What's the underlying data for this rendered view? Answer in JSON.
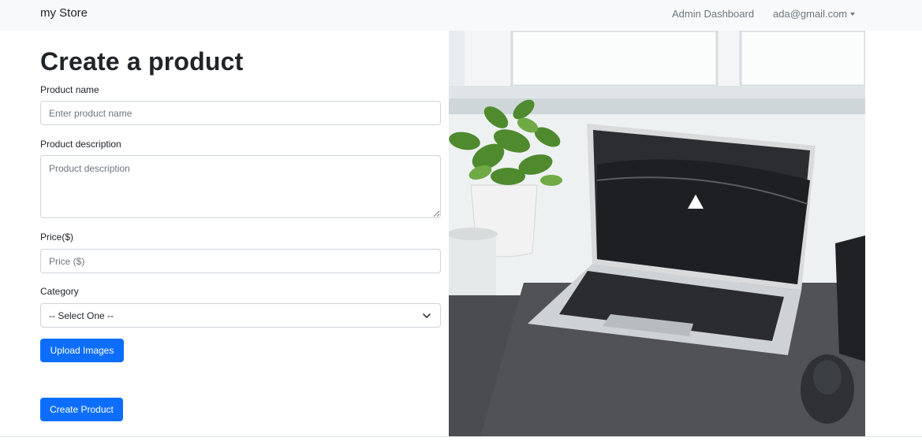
{
  "navbar": {
    "brand": "my Store",
    "admin_link": "Admin Dashboard",
    "user_email": "ada@gmail.com"
  },
  "form": {
    "title": "Create a product",
    "name_label": "Product name",
    "name_placeholder": "Enter product name",
    "description_label": "Product description",
    "description_placeholder": "Product description",
    "price_label": "Price($)",
    "price_placeholder": "Price ($)",
    "category_label": "Category",
    "category_selected": "-- Select One --",
    "upload_button": "Upload Images",
    "submit_button": "Create Product"
  },
  "hero_image": {
    "subject": "laptop on desk with plant"
  },
  "colors": {
    "primary": "#0d6efd",
    "navbar_bg": "#f8f9fa",
    "border": "#ced4da",
    "muted_text": "#6c757d"
  }
}
